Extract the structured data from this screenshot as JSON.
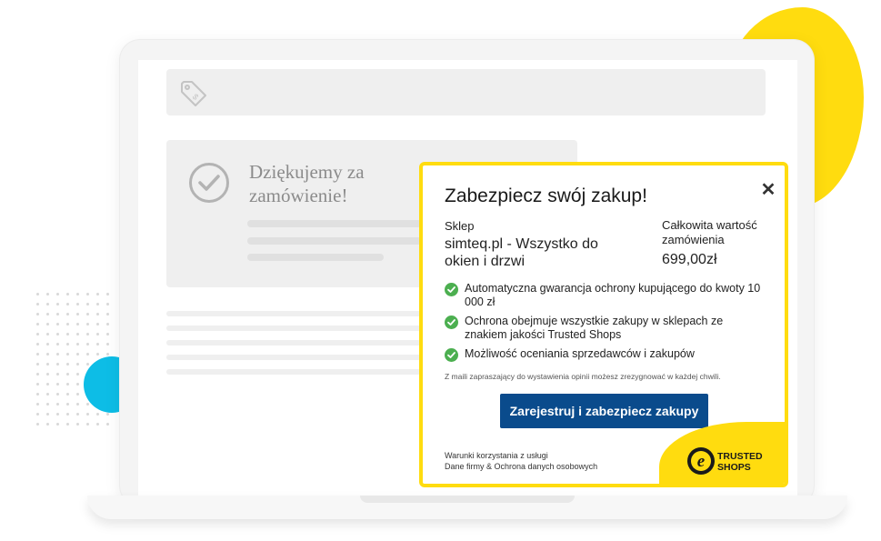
{
  "hero": {
    "heading_line1": "Dziękujemy za",
    "heading_line2": "zamówienie!"
  },
  "popup": {
    "title": "Zabezpiecz swój zakup!",
    "close_symbol": "✕",
    "shop_label": "Sklep",
    "shop_name": "simteq.pl - Wszystko do okien i drzwi",
    "total_label": "Całkowita wartość zamówienia",
    "total_value": "699,00zł",
    "benefits": [
      {
        "text": "Automatyczna gwarancja ochrony kupującego do kwoty 10 000 zł"
      },
      {
        "text": "Ochrona obejmuje wszystkie zakupy w sklepach ze znakiem jakości Trusted Shops"
      },
      {
        "text": "Możliwość oceniania sprzedawców i zakupów"
      }
    ],
    "disclaimer": "Z maili zapraszający do wystawienia opinii możesz zrezygnować w każdej chwili.",
    "cta_label": "Zarejestruj i zabezpiecz zakupy",
    "footer": {
      "terms_link": "Warunki korzystania z usługi",
      "privacy_link": "Dane firmy & Ochrona danych osobowych"
    },
    "logo": {
      "letter": "e",
      "line1": "TRUSTED",
      "line2": "SHOPS"
    }
  },
  "colors": {
    "accent_yellow": "#ffdc0f",
    "cta_blue": "#0a4b8c",
    "check_green": "#4caf50",
    "cyan": "#0dbde6"
  },
  "icons": {
    "address_bar": "price-tag-icon",
    "confirmation": "check-circle-icon",
    "benefit": "check-circle-icon",
    "close": "close-icon"
  }
}
